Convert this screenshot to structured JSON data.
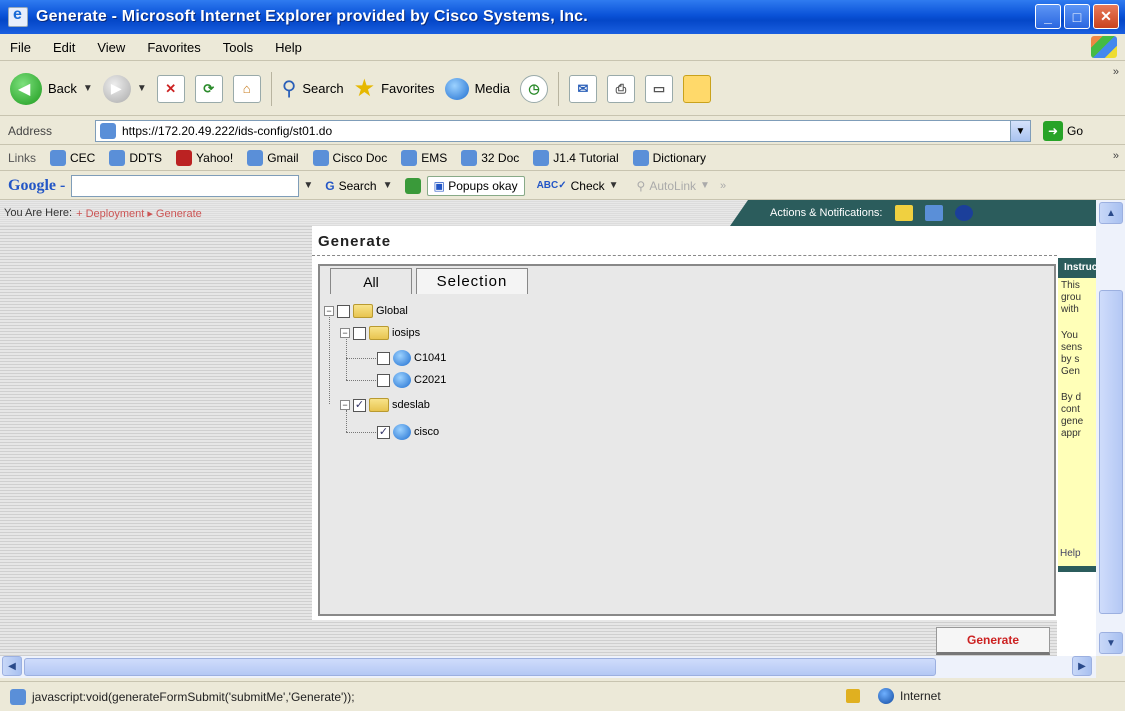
{
  "window": {
    "title": "Generate - Microsoft Internet Explorer provided by Cisco Systems, Inc.",
    "buttons": [
      "_",
      "□",
      "✕"
    ]
  },
  "menu": [
    "File",
    "Edit",
    "View",
    "Favorites",
    "Tools",
    "Help"
  ],
  "toolbar": {
    "back": "Back",
    "search": "Search",
    "favorites": "Favorites",
    "media": "Media",
    "more": "»"
  },
  "address": {
    "label": "Address",
    "url": "https://172.20.49.222/ids-config/st01.do",
    "go": "Go"
  },
  "links": {
    "label": "Links",
    "items": [
      "CEC",
      "DDTS",
      "Yahoo!",
      "Gmail",
      "Cisco Doc",
      "EMS",
      "32 Doc",
      "J1.4 Tutorial",
      "Dictionary"
    ],
    "more": "»"
  },
  "google": {
    "logo": "Google -",
    "search": "Search",
    "popups": "Popups okay",
    "check": "Check",
    "autolink": "AutoLink",
    "more": "»"
  },
  "page": {
    "you_are_here": "You Are Here:",
    "breadcrumb": "+ Deployment ▸ Generate",
    "actions": "Actions & Notifications:",
    "title": "Generate",
    "tabs": [
      "All",
      "Selection"
    ],
    "tree": [
      {
        "label": "Global",
        "type": "folder",
        "checked": ""
      },
      {
        "label": "iosips",
        "type": "folder",
        "checked": ""
      },
      {
        "label": "C1041",
        "type": "device",
        "checked": ""
      },
      {
        "label": "C2021",
        "type": "device",
        "checked": ""
      },
      {
        "label": "sdeslab",
        "type": "folder",
        "checked": "✓"
      },
      {
        "label": "cisco",
        "type": "device",
        "checked": "✓"
      }
    ],
    "generate_button": "Generate",
    "info": {
      "head": "Instructions",
      "para1": [
        "This",
        "grou",
        "with"
      ],
      "para2": [
        "You",
        "sens",
        "by s",
        "Gen"
      ],
      "para3": [
        "By d",
        "cont",
        "gene",
        "appr"
      ],
      "help": "Help"
    }
  },
  "status": {
    "text": "javascript:void(generateFormSubmit('submitMe','Generate'));",
    "zone": "Internet"
  }
}
